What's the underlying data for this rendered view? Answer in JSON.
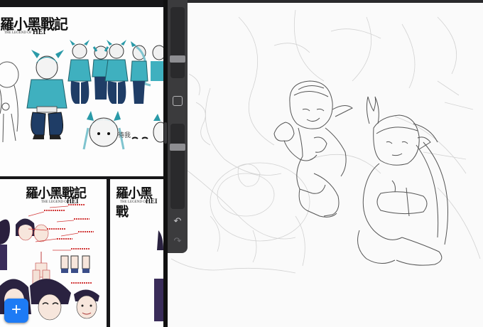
{
  "gallery": {
    "top_card": {
      "logo": "羅小黑戰記",
      "subtitle": "THE LEGEND OF",
      "subtitle2": "HEI",
      "note": "待我"
    },
    "bottom_left_card": {
      "logo": "羅小黑戰記",
      "subtitle": "THE LEGEND OF",
      "subtitle2": "HEI"
    },
    "bottom_right_card": {
      "logo": "羅小黑戰",
      "subtitle": "THE LEGEND OF",
      "subtitle2": "HEI"
    },
    "add_button_label": "+"
  },
  "toolbar": {
    "undo_icon": "↶",
    "redo_icon": "↷"
  },
  "colors": {
    "accent": "#1e7bf5",
    "toolbar": "#3b3b3d",
    "sketch_stroke": "#555555",
    "character_teal": "#2a9aa8"
  }
}
